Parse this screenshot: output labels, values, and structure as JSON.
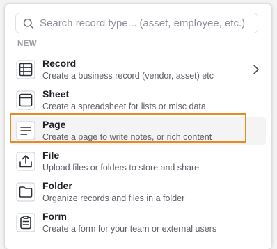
{
  "search": {
    "placeholder": "Search record type... (asset, employee, etc.)",
    "value": ""
  },
  "section": {
    "label": "NEW"
  },
  "items": [
    {
      "title": "Record",
      "description": "Create a business record (vendor, asset) etc",
      "icon": "table-grid-icon"
    },
    {
      "title": "Sheet",
      "description": "Create a spreadsheet for lists or misc data",
      "icon": "sheet-icon"
    },
    {
      "title": "Page",
      "description": "Create a page to write notes, or rich content",
      "icon": "page-lines-icon"
    },
    {
      "title": "File",
      "description": "Upload files or folders to store and share",
      "icon": "upload-icon"
    },
    {
      "title": "Folder",
      "description": "Organize records and files in a folder",
      "icon": "folder-icon"
    },
    {
      "title": "Form",
      "description": "Create a form for your team or external users",
      "icon": "clipboard-form-icon"
    }
  ],
  "colors": {
    "focus_outline": "#e88a24",
    "hover_background": "#f4f4f5"
  }
}
